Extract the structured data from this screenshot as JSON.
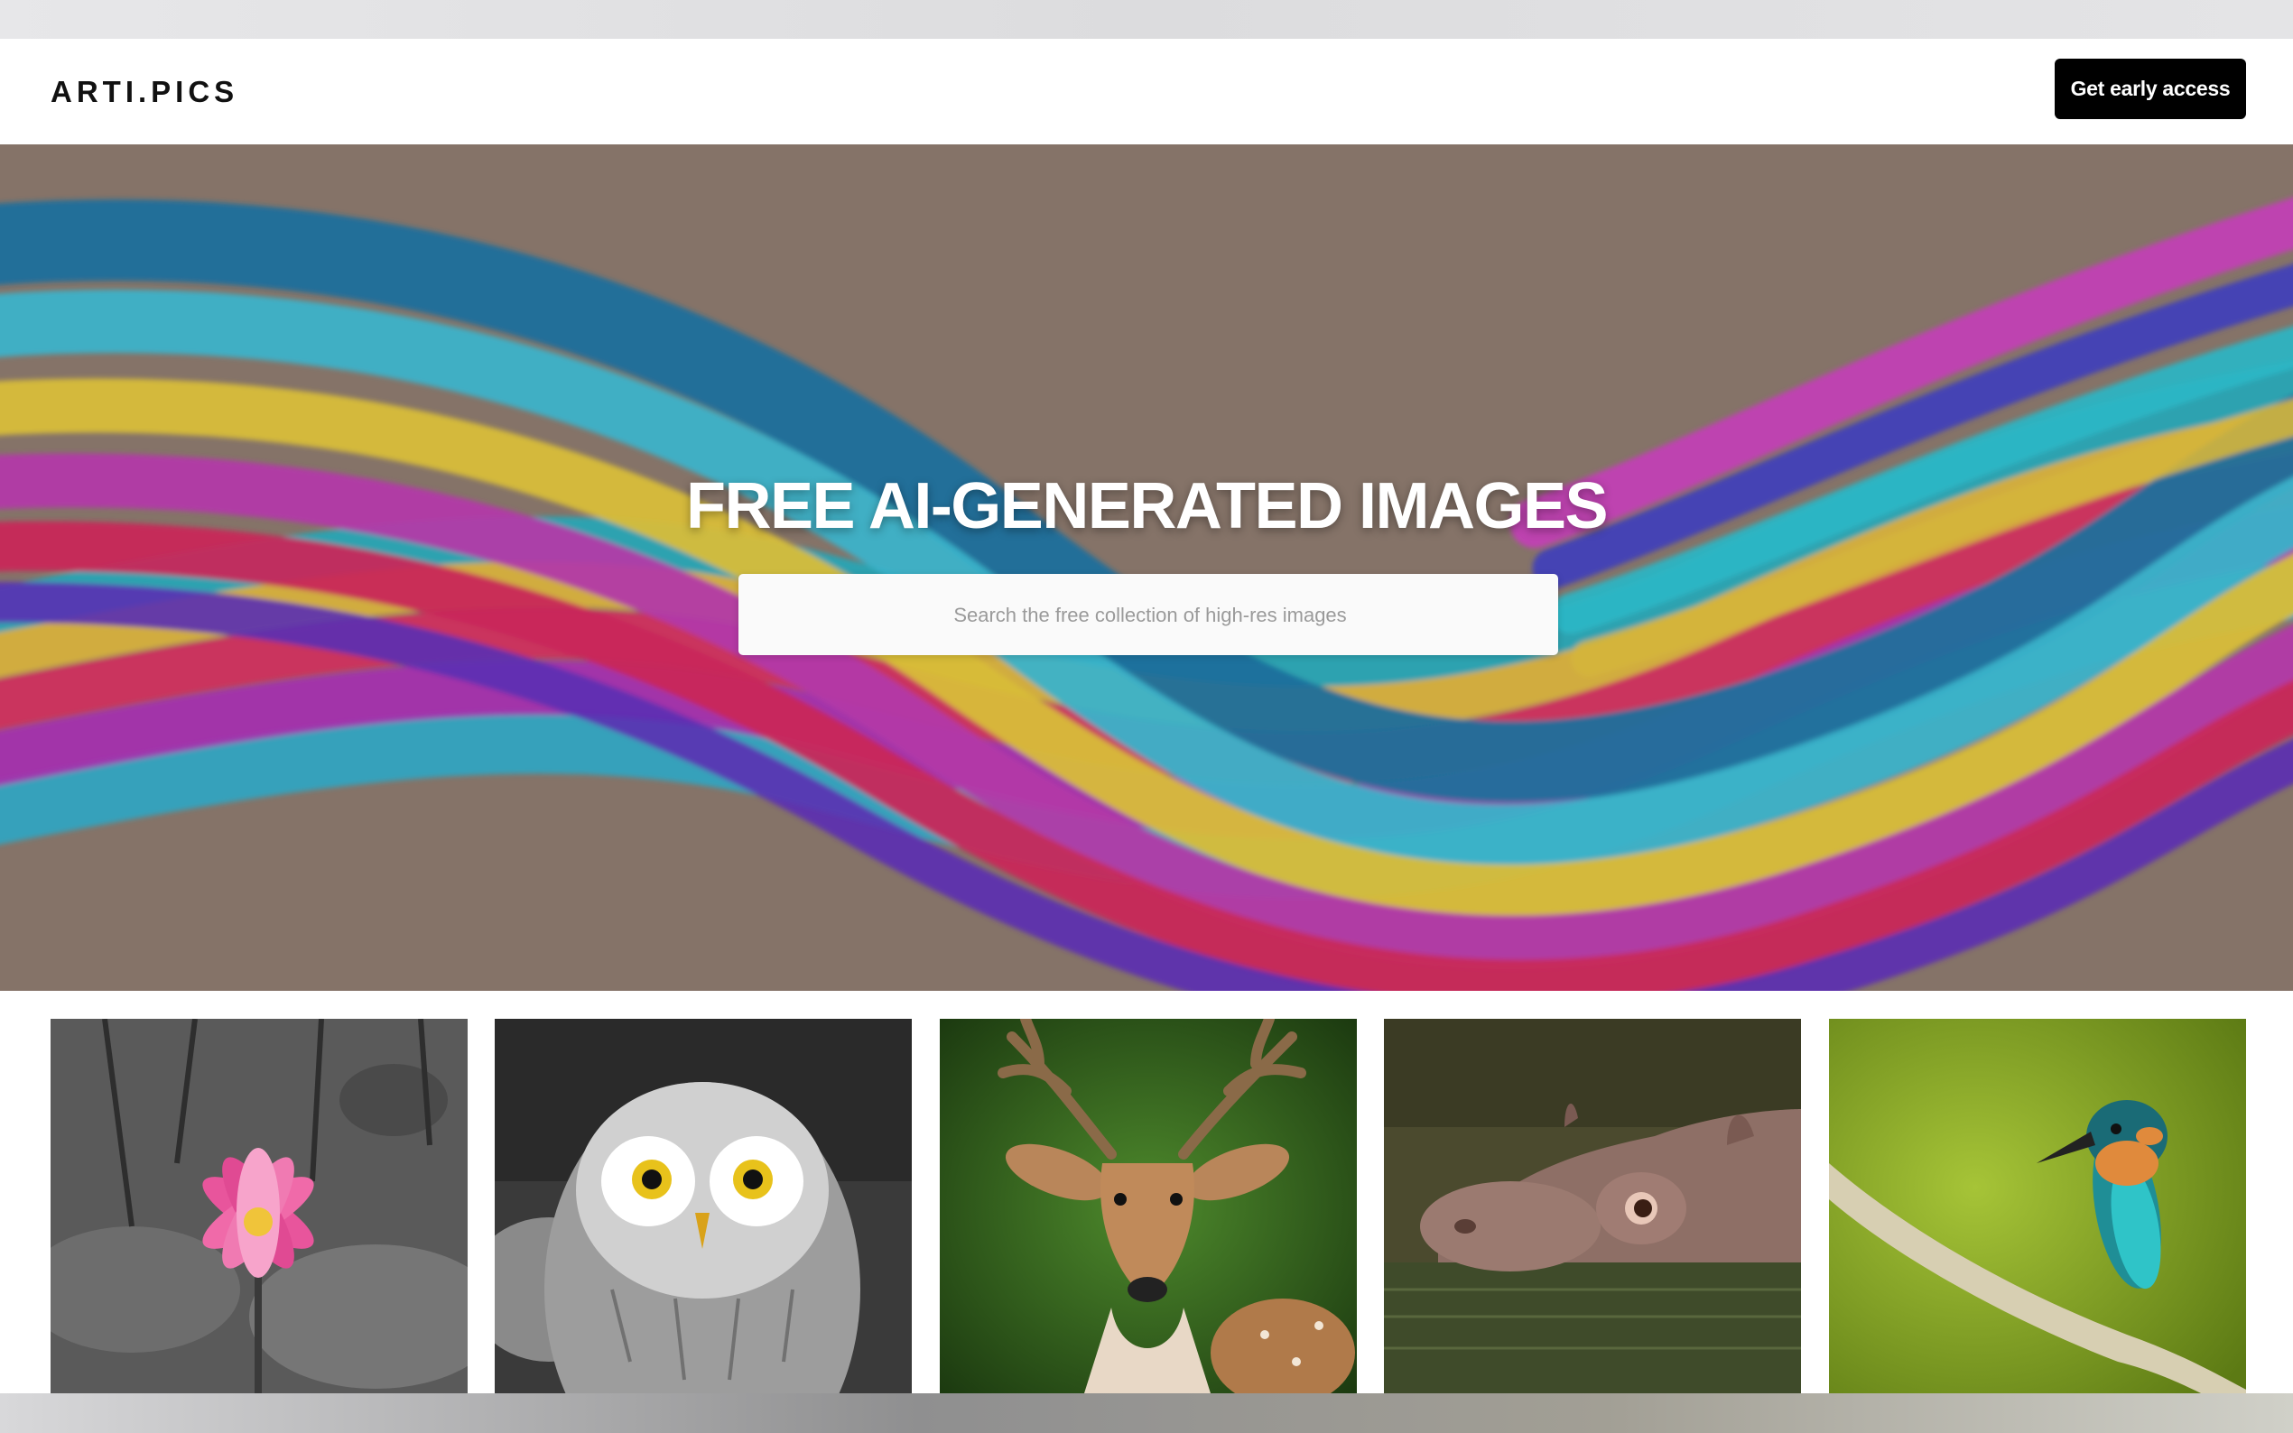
{
  "navbar": {
    "logo": "ARTI.PICS",
    "cta_label": "Get early access"
  },
  "hero": {
    "title": "FREE AI-GENERATED IMAGES",
    "search_placeholder": "Search the free collection of high-res images",
    "background_color": "#857368"
  },
  "gallery": {
    "items": [
      {
        "subject": "pink lotus flower on black-and-white background"
      },
      {
        "subject": "owl with yellow eyes, black and white"
      },
      {
        "subject": "deer with antlers on green background"
      },
      {
        "subject": "hippopotamus in water"
      },
      {
        "subject": "kingfisher on a branch"
      }
    ]
  },
  "colors": {
    "cta_bg": "#000000",
    "cta_text": "#ffffff",
    "hero_text": "#ffffff"
  }
}
